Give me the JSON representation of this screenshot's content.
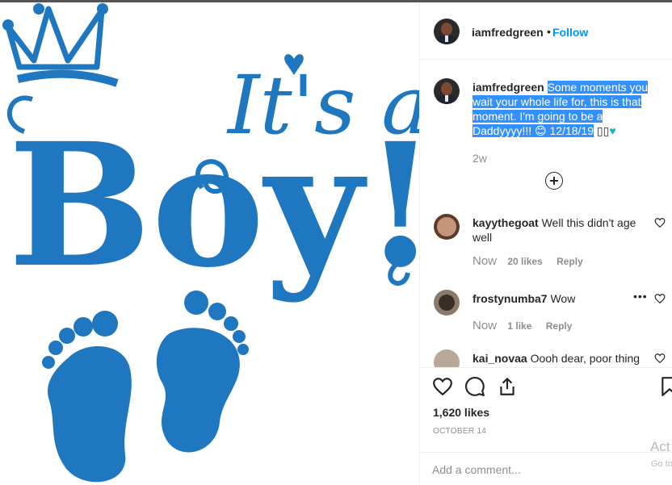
{
  "post": {
    "image_text": {
      "line1": "It's a",
      "line2": "Boy!"
    },
    "header": {
      "username": "iamfredgreen",
      "separator": "•",
      "follow_label": "Follow"
    },
    "caption": {
      "username": "iamfredgreen",
      "text": "Some moments you wait your whole life for, this is that moment. I'm going to be a Daddyyyy!!! 😊 12/18/19",
      "trailing": "▯▯",
      "heart": "♥",
      "time": "2w"
    },
    "comments": [
      {
        "username": "kayythegoat",
        "text": "Well this didn't age well",
        "when": "Now",
        "likes": "20 likes",
        "reply": "Reply"
      },
      {
        "username": "frostynumba7",
        "text": "Wow",
        "when": "Now",
        "likes": "1 like",
        "reply": "Reply",
        "more": "•••"
      },
      {
        "username": "kai_novaa",
        "text": "Oooh dear, poor thing"
      }
    ],
    "likes_count": "1,620 likes",
    "date": "OCTOBER 14",
    "add_comment_placeholder": "Add a comment..."
  },
  "icons": [
    "heart-icon",
    "comment-icon",
    "share-icon",
    "bookmark-icon",
    "add-circle-icon"
  ],
  "colors": {
    "accent": "#0095f6",
    "art_blue": "#1f77c0",
    "selection": "#3390ff"
  },
  "watermark": {
    "line1": "Act",
    "line2": "Go to"
  }
}
